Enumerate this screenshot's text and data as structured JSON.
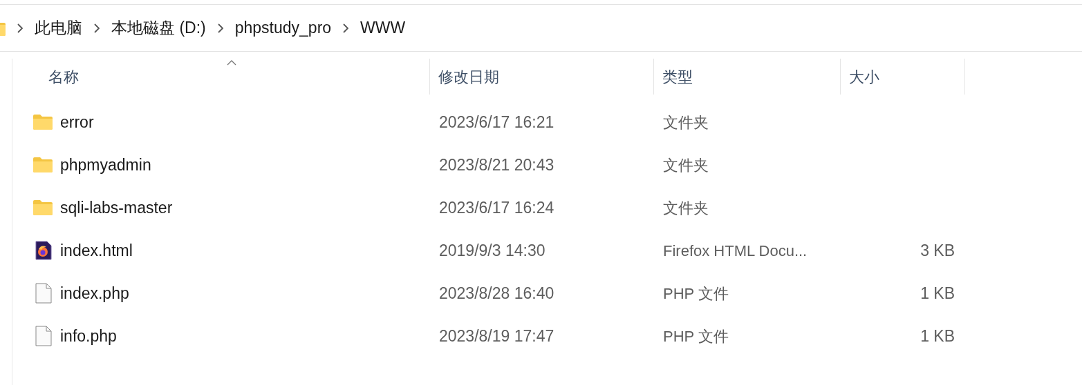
{
  "breadcrumb": [
    {
      "label": "此电脑"
    },
    {
      "label": "本地磁盘 (D:)"
    },
    {
      "label": "phpstudy_pro"
    },
    {
      "label": "WWW"
    }
  ],
  "columns": [
    {
      "label": "名称",
      "sorted": true
    },
    {
      "label": "修改日期",
      "sorted": false
    },
    {
      "label": "类型",
      "sorted": false
    },
    {
      "label": "大小",
      "sorted": false
    }
  ],
  "rows": [
    {
      "kind": "folder",
      "name": "error",
      "modified": "2023/6/17 16:21",
      "type": "文件夹"
    },
    {
      "kind": "folder",
      "name": "phpmyadmin",
      "modified": "2023/8/21 20:43",
      "type": "文件夹"
    },
    {
      "kind": "folder",
      "name": "sqli-labs-master",
      "modified": "2023/6/17 16:24",
      "type": "文件夹"
    },
    {
      "kind": "firefox",
      "name": "index.html",
      "modified": "2019/9/3 14:30",
      "type": "Firefox HTML Docu...",
      "size": "3 KB"
    },
    {
      "kind": "file",
      "name": "index.php",
      "modified": "2023/8/28 16:40",
      "type": "PHP 文件",
      "size": "1 KB"
    },
    {
      "kind": "file",
      "name": "info.php",
      "modified": "2023/8/19 17:47",
      "type": "PHP 文件",
      "size": "1 KB"
    }
  ]
}
